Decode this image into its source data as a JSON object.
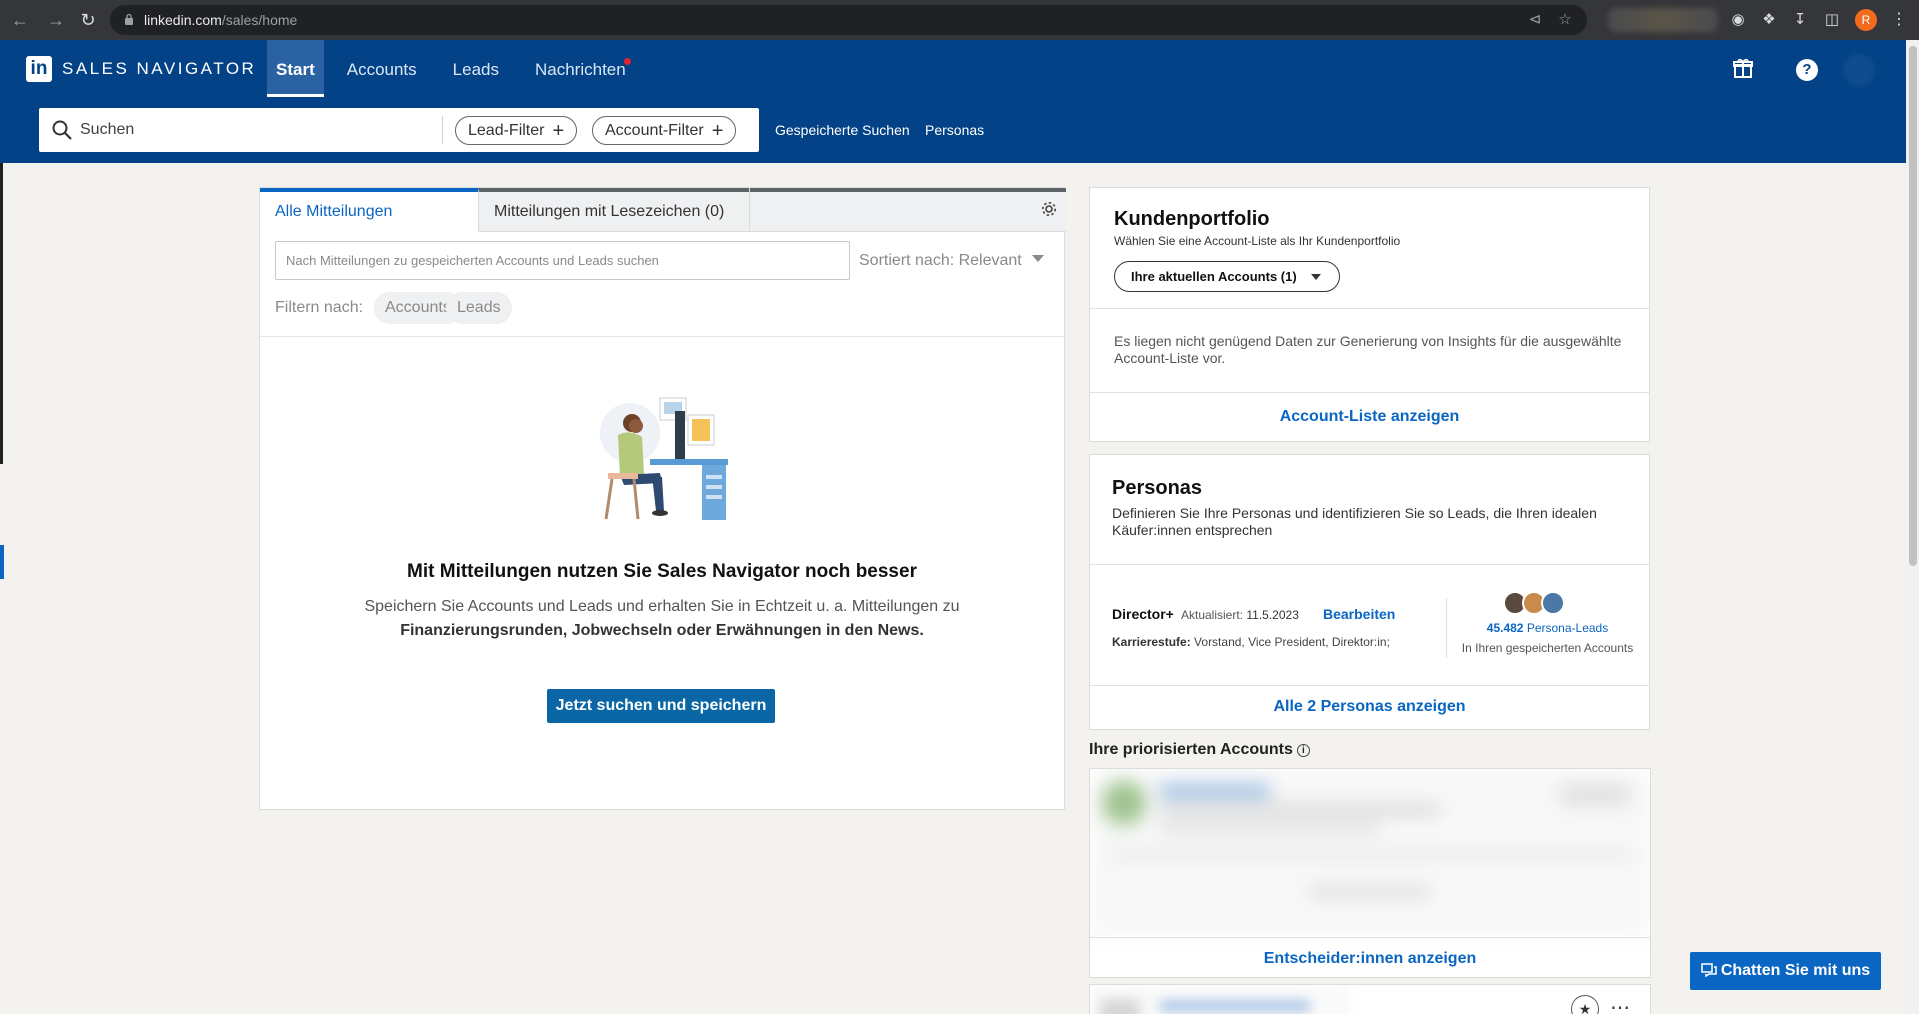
{
  "browser": {
    "url_host": "linkedin.com",
    "url_path": "/sales/home",
    "profile_initial": "R"
  },
  "header": {
    "brand": "SALES NAVIGATOR",
    "nav": [
      {
        "label": "Start",
        "active": true
      },
      {
        "label": "Accounts",
        "active": false
      },
      {
        "label": "Leads",
        "active": false
      },
      {
        "label": "Nachrichten",
        "active": false,
        "notification": true
      }
    ]
  },
  "search": {
    "placeholder": "Suchen",
    "lead_filter": "Lead-Filter",
    "account_filter": "Account-Filter",
    "saved_searches": "Gespeicherte Suchen",
    "personas": "Personas"
  },
  "feed": {
    "tabs": [
      "Alle Mitteilungen",
      "Mitteilungen mit Lesezeichen (0)"
    ],
    "search_placeholder": "Nach Mitteilungen zu gespeicherten Accounts und Leads suchen",
    "sort_label": "Sortiert nach: Relevant",
    "filter_label": "Filtern nach:",
    "filter_chips": [
      "Accounts",
      "Leads"
    ],
    "empty_title": "Mit Mitteilungen nutzen Sie Sales Navigator noch besser",
    "empty_desc_1": "Speichern Sie Accounts und Leads und erhalten Sie in Echtzeit u. a. Mitteilungen zu",
    "empty_desc_2": "Finanzierungsrunden, Jobwechseln oder Erwähnungen in den News.",
    "cta": "Jetzt suchen und speichern"
  },
  "portfolio": {
    "title": "Kundenportfolio",
    "subtitle": "Wählen Sie eine Account-Liste als Ihr Kundenportfolio",
    "dropdown": "Ihre aktuellen Accounts (1)",
    "info": "Es liegen nicht genügend Daten zur Generierung von Insights für die ausgewählte Account-Liste vor.",
    "link": "Account-Liste anzeigen"
  },
  "personas": {
    "title": "Personas",
    "description": "Definieren Sie Ihre Personas und identifizieren Sie so Leads, die Ihren idealen Käufer:innen entsprechen",
    "name": "Director+",
    "updated_label": "Aktualisiert:",
    "updated_date": "11.5.2023",
    "edit": "Bearbeiten",
    "career_label": "Karrierestufe:",
    "career_value": "Vorstand, Vice President, Direktor:in;",
    "lead_count": "45.482",
    "lead_count_label": "Persona-Leads",
    "lead_count_sub": "In Ihren gespeicherten Accounts",
    "link": "Alle 2 Personas anzeigen"
  },
  "prioritized": {
    "title": "Ihre priorisierten Accounts",
    "link": "Entscheider:innen anzeigen"
  },
  "chat": {
    "label": "Chatten Sie mit uns"
  },
  "colors": {
    "header_blue": "#034287",
    "link_blue": "#0a66c2",
    "cta_blue": "#0b66a6",
    "notification_red": "#e0232f"
  }
}
